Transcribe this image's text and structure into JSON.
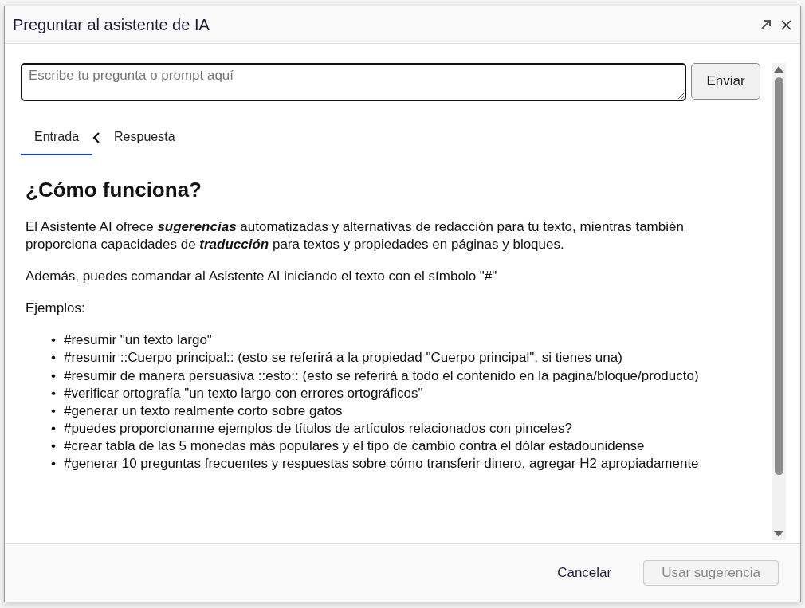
{
  "dialog": {
    "title": "Preguntar al asistente de IA"
  },
  "prompt": {
    "placeholder": "Escribe tu pregunta o prompt aquí",
    "send_button": "Enviar"
  },
  "tabs": [
    {
      "label": "Entrada",
      "selected": true
    },
    {
      "label": "Respuesta",
      "selected": false
    }
  ],
  "content": {
    "heading": "¿Cómo funciona?",
    "paragraphs": [
      "El Asistente AI ofrece **sugerencias** automatizadas y alternativas de redacción para tu texto, mientras también proporciona capacidades de **traducción** para textos y propiedades en páginas y bloques.",
      "Además, puedes comandar al Asistente AI iniciando el texto con el símbolo \"#\"",
      "Ejemplos:"
    ],
    "examples": [
      {
        "marker": "•",
        "text": "#resumir \"un texto largo\""
      },
      {
        "marker": "•",
        "text": "#resumir ::Cuerpo principal:: (esto se referirá a la propiedad \"Cuerpo principal\", si tienes una)"
      },
      {
        "marker": "•",
        "text": "#resumir de manera persuasiva ::esto:: (esto se referirá a todo el contenido en la página/bloque/producto)"
      },
      {
        "marker": "•",
        "text": "#verificar ortografía \"un texto largo con errores ortográficos\""
      },
      {
        "marker": "•",
        "text": "#generar un texto realmente corto sobre gatos"
      },
      {
        "marker": "•",
        "text": "#puedes proporcionarme ejemplos de títulos de artículos relacionados con pinceles?"
      },
      {
        "marker": "•",
        "text": "#crear tabla de las 5 monedas más populares y el tipo de cambio contra el dólar estadounidense"
      },
      {
        "marker": "•",
        "text": "#generar 10 preguntas frecuentes y respuestas sobre cómo transferir dinero, agregar H2 apropiadamente"
      }
    ]
  },
  "footer": {
    "cancel": "Cancelar",
    "use_button": {
      "label": "Usar sugerencia",
      "disabled": true
    }
  }
}
